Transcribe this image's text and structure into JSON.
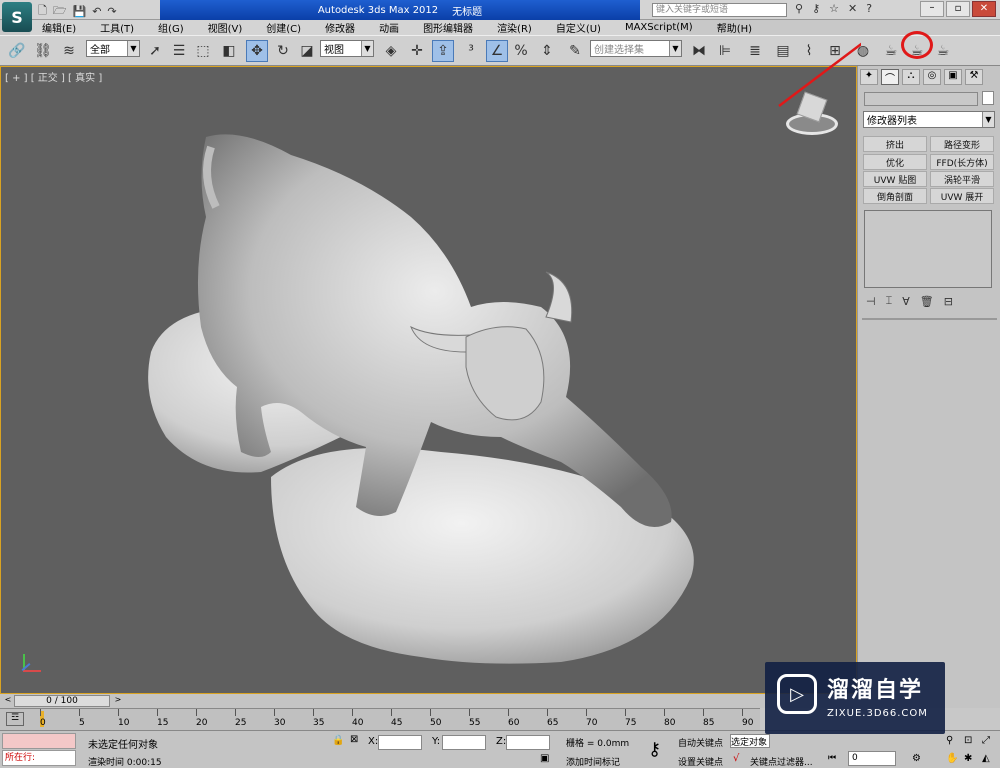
{
  "app": {
    "title": "Autodesk 3ds Max  2012",
    "subtitle": "无标题",
    "search_placeholder": "键入关键字或短语"
  },
  "menu": [
    "编辑(E)",
    "工具(T)",
    "组(G)",
    "视图(V)",
    "创建(C)",
    "修改器",
    "动画",
    "图形编辑器",
    "渲染(R)",
    "自定义(U)",
    "MAXScript(M)",
    "帮助(H)"
  ],
  "toolbar": {
    "selection_filter": "全部",
    "ref_coord": "视图",
    "named_selection": "创建选择集"
  },
  "viewport": {
    "label": "[ + ] [ 正交 ] [ 真实 ]"
  },
  "command_panel": {
    "modifier_list": "修改器列表",
    "buttons": [
      "挤出",
      "路径变形",
      "优化",
      "FFD(长方体)",
      "UVW 贴图",
      "涡轮平滑",
      "倒角剖面",
      "UVW 展开"
    ]
  },
  "timeline": {
    "frame_counter": "0 / 100",
    "ticks": [
      "0",
      "5",
      "10",
      "15",
      "20",
      "25",
      "30",
      "35",
      "40",
      "45",
      "50",
      "55",
      "60",
      "65",
      "70",
      "75",
      "80",
      "85",
      "90"
    ]
  },
  "status": {
    "running": "所在行:",
    "selection_msg": "未选定任何对象",
    "render_time": "渲染时间  0:00:15",
    "x_label": "X:",
    "y_label": "Y:",
    "z_label": "Z:",
    "grid": "栅格 = 0.0mm",
    "add_time_tag": "添加时间标记",
    "auto_key": "自动关键点",
    "set_key": "设置关键点",
    "selected_obj": "选定对象",
    "key_filters": "关键点过滤器...",
    "frame_value": "0"
  },
  "watermark": {
    "brand": "溜溜自学",
    "url": "ZIXUE.3D66.COM"
  },
  "colors": {
    "viewport_bg": "#5f5f5f",
    "viewport_border": "#d9a322",
    "annotation": "#e01818"
  }
}
